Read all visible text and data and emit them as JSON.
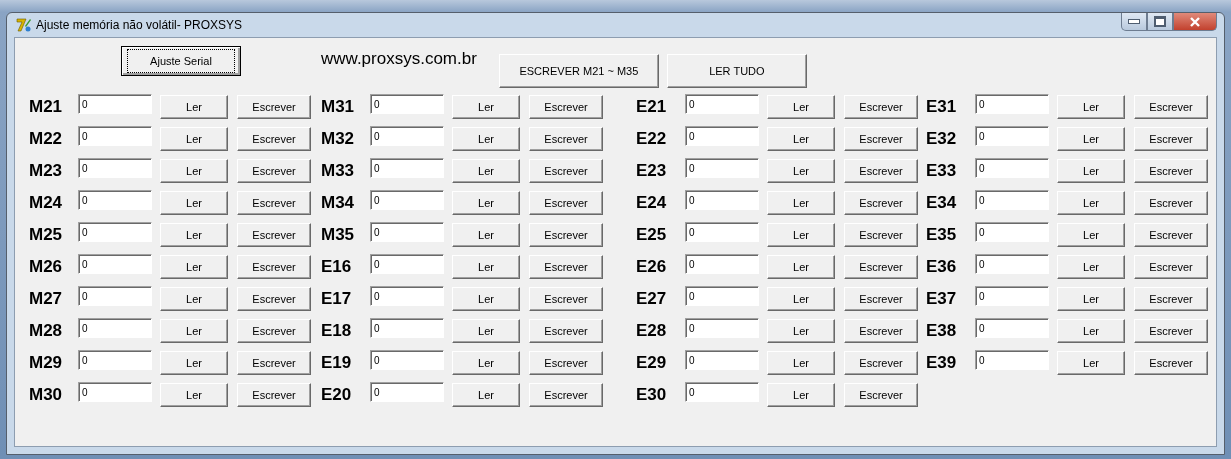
{
  "window": {
    "title": "Ajuste memória não volátil- PROXSYS"
  },
  "toolbar": {
    "serial_button": "Ajuste Serial",
    "website": "www.proxsys.com.br",
    "write_all_button": "ESCREVER M21 ~ M35",
    "read_all_button": "LER TUDO"
  },
  "columns": [
    {
      "entries": [
        {
          "label": "M21",
          "value": "0",
          "read": "Ler",
          "write": "Escrever"
        },
        {
          "label": "M22",
          "value": "0",
          "read": "Ler",
          "write": "Escrever"
        },
        {
          "label": "M23",
          "value": "0",
          "read": "Ler",
          "write": "Escrever"
        },
        {
          "label": "M24",
          "value": "0",
          "read": "Ler",
          "write": "Escrever"
        },
        {
          "label": "M25",
          "value": "0",
          "read": "Ler",
          "write": "Escrever"
        },
        {
          "label": "M26",
          "value": "0",
          "read": "Ler",
          "write": "Escrever"
        },
        {
          "label": "M27",
          "value": "0",
          "read": "Ler",
          "write": "Escrever"
        },
        {
          "label": "M28",
          "value": "0",
          "read": "Ler",
          "write": "Escrever"
        },
        {
          "label": "M29",
          "value": "0",
          "read": "Ler",
          "write": "Escrever"
        },
        {
          "label": "M30",
          "value": "0",
          "read": "Ler",
          "write": "Escrever"
        }
      ]
    },
    {
      "entries": [
        {
          "label": "M31",
          "value": "0",
          "read": "Ler",
          "write": "Escrever"
        },
        {
          "label": "M32",
          "value": "0",
          "read": "Ler",
          "write": "Escrever"
        },
        {
          "label": "M33",
          "value": "0",
          "read": "Ler",
          "write": "Escrever"
        },
        {
          "label": "M34",
          "value": "0",
          "read": "Ler",
          "write": "Escrever"
        },
        {
          "label": "M35",
          "value": "0",
          "read": "Ler",
          "write": "Escrever"
        },
        {
          "label": "E16",
          "value": "0",
          "read": "Ler",
          "write": "Escrever"
        },
        {
          "label": "E17",
          "value": "0",
          "read": "Ler",
          "write": "Escrever"
        },
        {
          "label": "E18",
          "value": "0",
          "read": "Ler",
          "write": "Escrever"
        },
        {
          "label": "E19",
          "value": "0",
          "read": "Ler",
          "write": "Escrever"
        },
        {
          "label": "E20",
          "value": "0",
          "read": "Ler",
          "write": "Escrever"
        }
      ]
    },
    {
      "entries": [
        {
          "label": "E21",
          "value": "0",
          "read": "Ler",
          "write": "Escrever"
        },
        {
          "label": "E22",
          "value": "0",
          "read": "Ler",
          "write": "Escrever"
        },
        {
          "label": "E23",
          "value": "0",
          "read": "Ler",
          "write": "Escrever"
        },
        {
          "label": "E24",
          "value": "0",
          "read": "Ler",
          "write": "Escrever"
        },
        {
          "label": "E25",
          "value": "0",
          "read": "Ler",
          "write": "Escrever"
        },
        {
          "label": "E26",
          "value": "0",
          "read": "Ler",
          "write": "Escrever"
        },
        {
          "label": "E27",
          "value": "0",
          "read": "Ler",
          "write": "Escrever"
        },
        {
          "label": "E28",
          "value": "0",
          "read": "Ler",
          "write": "Escrever"
        },
        {
          "label": "E29",
          "value": "0",
          "read": "Ler",
          "write": "Escrever"
        },
        {
          "label": "E30",
          "value": "0",
          "read": "Ler",
          "write": "Escrever"
        }
      ]
    },
    {
      "entries": [
        {
          "label": "E31",
          "value": "0",
          "read": "Ler",
          "write": "Escrever"
        },
        {
          "label": "E32",
          "value": "0",
          "read": "Ler",
          "write": "Escrever"
        },
        {
          "label": "E33",
          "value": "0",
          "read": "Ler",
          "write": "Escrever"
        },
        {
          "label": "E34",
          "value": "0",
          "read": "Ler",
          "write": "Escrever"
        },
        {
          "label": "E35",
          "value": "0",
          "read": "Ler",
          "write": "Escrever"
        },
        {
          "label": "E36",
          "value": "0",
          "read": "Ler",
          "write": "Escrever"
        },
        {
          "label": "E37",
          "value": "0",
          "read": "Ler",
          "write": "Escrever"
        },
        {
          "label": "E38",
          "value": "0",
          "read": "Ler",
          "write": "Escrever"
        },
        {
          "label": "E39",
          "value": "0",
          "read": "Ler",
          "write": "Escrever"
        }
      ]
    }
  ]
}
